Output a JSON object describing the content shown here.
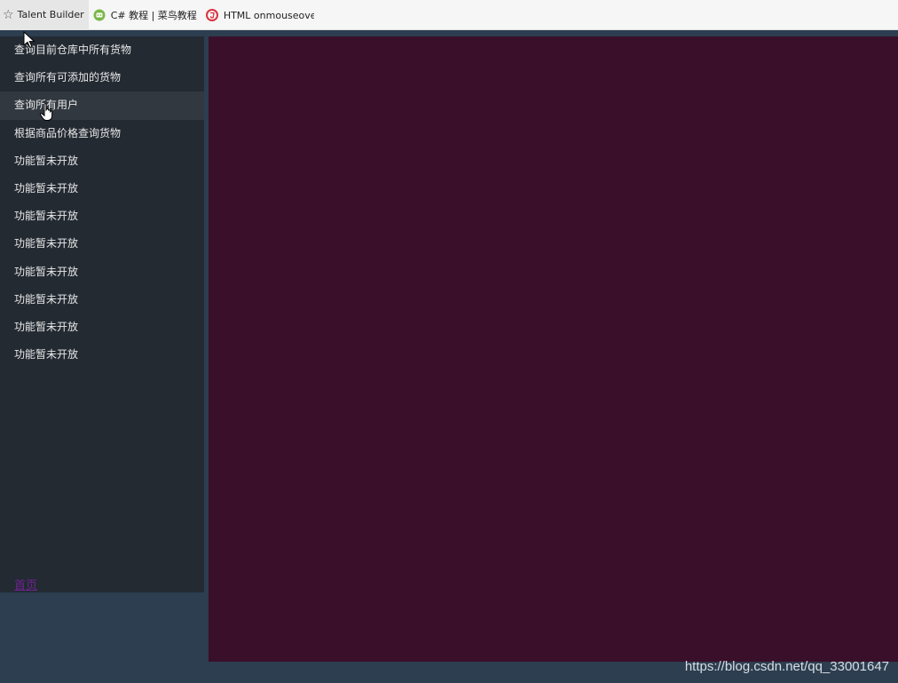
{
  "bookmarks": [
    {
      "label": "Talent Builder",
      "icon": "star-icon"
    },
    {
      "label": "C# 教程 | 菜鸟教程",
      "icon": "runoob-icon"
    },
    {
      "label": "HTML onmouseover 事件",
      "icon": "html5-icon"
    }
  ],
  "sidebar": {
    "items": [
      {
        "label": "查询目前仓库中所有货物"
      },
      {
        "label": "查询所有可添加的货物"
      },
      {
        "label": "查询所有用户",
        "active": true
      },
      {
        "label": "根据商品价格查询货物"
      },
      {
        "label": "功能暂未开放"
      },
      {
        "label": "功能暂未开放"
      },
      {
        "label": "功能暂未开放"
      },
      {
        "label": "功能暂未开放"
      },
      {
        "label": "功能暂未开放"
      },
      {
        "label": "功能暂未开放"
      },
      {
        "label": "功能暂未开放"
      },
      {
        "label": "功能暂未开放"
      }
    ],
    "home_link": "首页"
  },
  "watermark": "https://blog.csdn.net/qq_33001647",
  "colors": {
    "page_bg": "#2c3e50",
    "sidebar_bg": "#232a32",
    "sidebar_active_bg": "#31383f",
    "content_bg": "#3a0f2a",
    "link_color": "#6f2393"
  }
}
